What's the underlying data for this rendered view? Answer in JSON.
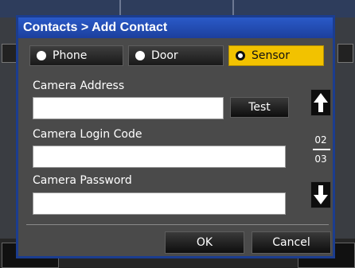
{
  "dialog": {
    "title": "Contacts > Add Contact"
  },
  "contact_type": {
    "options": [
      {
        "label": "Phone",
        "selected": false
      },
      {
        "label": "Door",
        "selected": false
      },
      {
        "label": "Sensor",
        "selected": true
      }
    ]
  },
  "fields": {
    "camera_address": {
      "label": "Camera Address",
      "value": ""
    },
    "camera_login_code": {
      "label": "Camera Login Code",
      "value": ""
    },
    "camera_password": {
      "label": "Camera Password",
      "value": ""
    }
  },
  "test_button": {
    "label": "Test"
  },
  "pager": {
    "current": "02",
    "total": "03",
    "up_icon": "arrow-up-icon",
    "down_icon": "arrow-down-icon"
  },
  "footer": {
    "ok_label": "OK",
    "cancel_label": "Cancel"
  },
  "colors": {
    "title_bar": "#1c3f9d",
    "selected_option": "#f2c200",
    "dialog_bg": "#4a4a4a"
  }
}
